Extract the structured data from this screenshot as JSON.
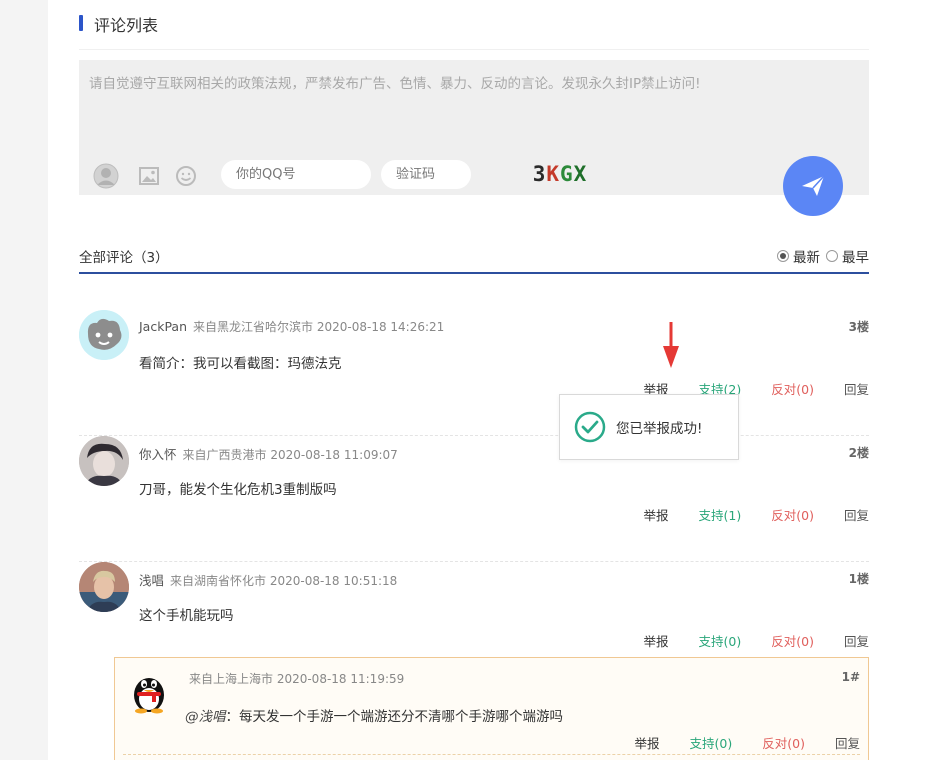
{
  "section": {
    "title": "评论列表"
  },
  "editor": {
    "placeholder": "请自觉遵守互联网相关的政策法规，严禁发布广告、色情、暴力、反动的言论。发现永久封IP禁止访问!",
    "qq_placeholder": "你的QQ号",
    "captcha_placeholder": "验证码",
    "captcha_chars": [
      {
        "ch": "3",
        "color": "#2a2a2a"
      },
      {
        "ch": "K",
        "color": "#c43a2a"
      },
      {
        "ch": "G",
        "color": "#2c8a3a"
      },
      {
        "ch": "X",
        "color": "#1f6f2a"
      }
    ],
    "tool_icons": [
      "avatar-icon",
      "image-icon",
      "emoji-icon"
    ],
    "send_icon": "paper-plane-icon",
    "accent": "#5b86f5"
  },
  "list": {
    "count_label": "全部评论（3）",
    "sort_newest": "最新",
    "sort_oldest": "最早",
    "sort_selected": "最新"
  },
  "comments": [
    {
      "author": "JackPan",
      "location_time": "来自黑龙江省哈尔滨市 2020-08-18 14:26:21",
      "floor": "3楼",
      "text": "看简介：我可以看截图：玛德法克",
      "report": "举报",
      "support": "支持(2)",
      "oppose": "反对(0)",
      "reply": "回复"
    },
    {
      "author": "你入怀",
      "location_time": "来自广西贵港市 2020-08-18 11:09:07",
      "floor": "2楼",
      "text": "刀哥，能发个生化危机3重制版吗",
      "report": "举报",
      "support": "支持(1)",
      "oppose": "反对(0)",
      "reply": "回复"
    },
    {
      "author": "浅唱",
      "location_time": "来自湖南省怀化市 2020-08-18 10:51:18",
      "floor": "1楼",
      "text": "这个手机能玩吗",
      "report": "举报",
      "support": "支持(0)",
      "oppose": "反对(0)",
      "reply": "回复"
    }
  ],
  "reply": {
    "location_time": "来自上海上海市 2020-08-18 11:19:59",
    "floor": "1#",
    "mention": "@浅唱",
    "text": "：每天发一个手游一个端游还分不清哪个手游哪个端游吗",
    "report": "举报",
    "support": "支持(0)",
    "oppose": "反对(0)",
    "reply": "回复"
  },
  "toast": {
    "message": "您已举报成功!",
    "icon": "check-circle-icon"
  },
  "colors": {
    "support": "#2aa67a",
    "oppose": "#e0605d",
    "section_bar": "#2c55c9",
    "arrow": "#e53935"
  }
}
